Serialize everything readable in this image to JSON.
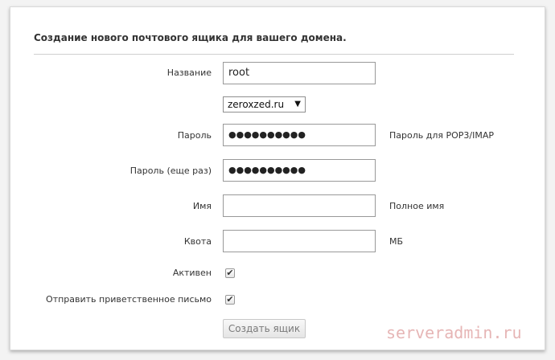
{
  "form": {
    "title": "Создание нового почтового ящика для вашего домена.",
    "fields": {
      "name": {
        "label": "Название",
        "value": "root"
      },
      "domain": {
        "selected": "zeroxzed.ru"
      },
      "password": {
        "label": "Пароль",
        "masked_value": "●●●●●●●●●●",
        "hint": "Пароль для POP3/IMAP"
      },
      "password_repeat": {
        "label": "Пароль (еще раз)",
        "masked_value": "●●●●●●●●●●"
      },
      "full_name": {
        "label": "Имя",
        "value": "",
        "hint": "Полное имя"
      },
      "quota": {
        "label": "Квота",
        "value": "",
        "hint": "МБ"
      },
      "active": {
        "label": "Активен",
        "checked": true
      },
      "welcome_email": {
        "label": "Отправить приветственное письмо",
        "checked": true
      }
    },
    "submit_label": "Создать ящик"
  },
  "watermark": "serveradmin.ru",
  "colors": {
    "background": "#ffffff",
    "border": "#999999",
    "button_text": "#7a7a7a",
    "watermark": "#c85a5a"
  },
  "icons": {
    "dropdown": "chevron-down-icon",
    "checkbox": "checkmark-icon"
  }
}
